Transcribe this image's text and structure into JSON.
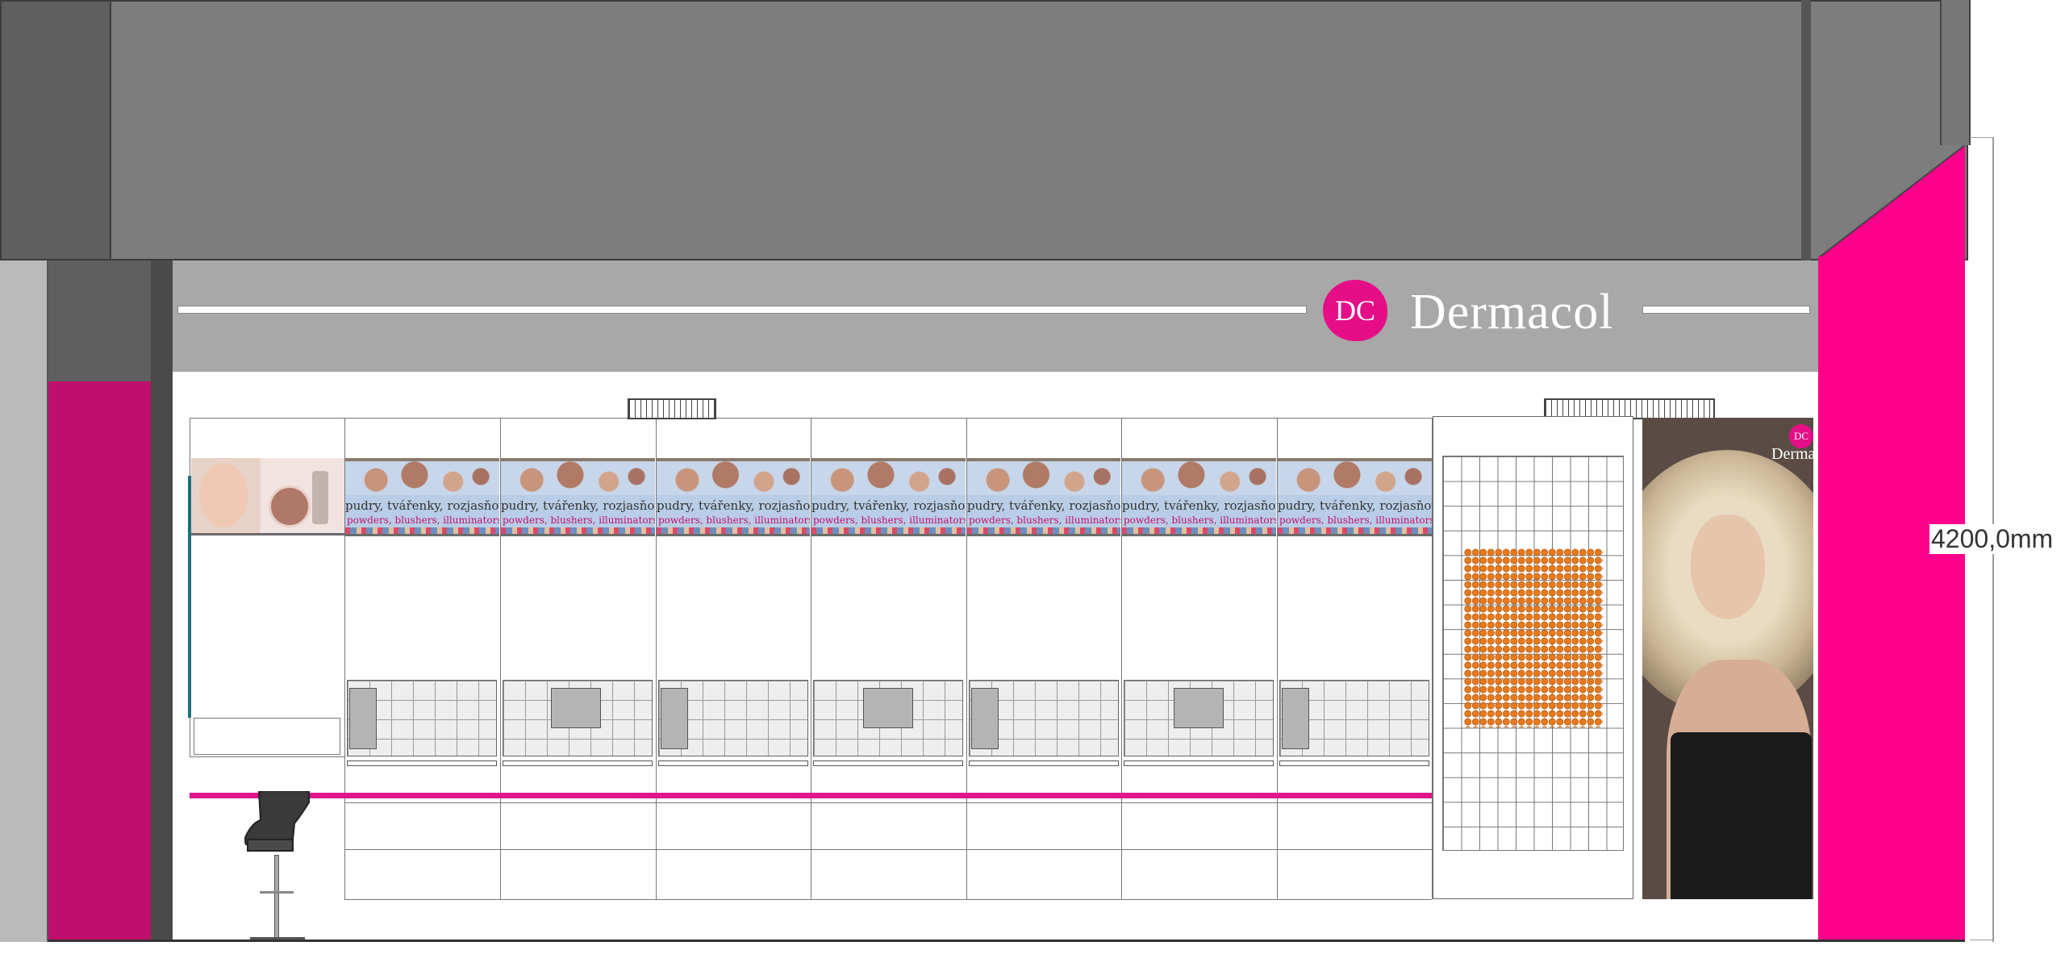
{
  "brand": {
    "logo_mark": "DC",
    "name": "Dermacol",
    "accent_color": "#ff008c",
    "wall_pink_dark": "#bf0f6d"
  },
  "dimension": {
    "height_label": "4200,0mm"
  },
  "banners": [
    {
      "line1": "pudry, tvářenky, rozjasňovače",
      "line2": "powders, blushers, illuminators & bronzers"
    },
    {
      "line1": "pudry, tvářenky, rozjasňovače",
      "line2": "powders, blushers, illuminators & bronzers"
    },
    {
      "line1": "pudry, tvářenky, rozjasňovače",
      "line2": "powders, blushers, illuminators & bronzers"
    },
    {
      "line1": "pudry, tvářenky, rozjasňovače",
      "line2": "powders, blushers, illuminators & bronzers"
    },
    {
      "line1": "pudry, tvářenky, rozjasňovače",
      "line2": "powders, blushers, illuminators & bronzers"
    },
    {
      "line1": "pudry, tvářenky, rozjasňovače",
      "line2": "powders, blushers, illuminators & bronzers"
    },
    {
      "line1": "pudry, tvářenky, rozjasňovače",
      "line2": "powders, blushers, illuminators & bronzers"
    }
  ],
  "poster": {
    "logo_mark": "DC",
    "brand": "Derma"
  },
  "icons": [
    "logo-icon",
    "stool-icon",
    "ceiling-light-icon"
  ]
}
